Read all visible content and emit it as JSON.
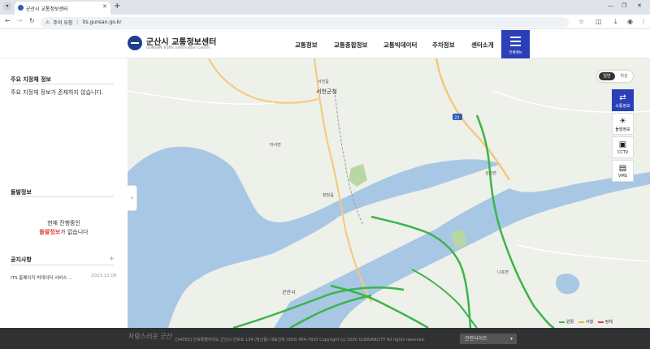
{
  "browser": {
    "tab_title": "군산시 교통정보센터",
    "warning": "주의 요함",
    "url": "its.gunsan.go.kr"
  },
  "header": {
    "logo_title": "군산시 교통정보센터",
    "logo_sub": "GUNSAN Traffic Information Center",
    "menu": [
      "교통정보",
      "교통종합정보",
      "교통빅데이터",
      "주차정보",
      "센터소개"
    ],
    "allmenu_label": "전체메뉴"
  },
  "sidebar": {
    "major": {
      "title": "주요 지정체 정보",
      "text": "주요 지정체 정보가 존재하지 않습니다."
    },
    "incident": {
      "title": "돌발정보",
      "line1": "현재 진행중인",
      "highlight": "돌발정보",
      "suffix": "가 없습니다"
    },
    "notice": {
      "title": "공지사항",
      "plus": "+",
      "item_title": "ITS 홈페이지 빅데이터 서비스 ...",
      "item_date": "2023.12.06"
    }
  },
  "map": {
    "toggle": {
      "normal": "일반",
      "satellite": "위성"
    },
    "buttons": [
      {
        "label": "소통정보",
        "icon": "⇄"
      },
      {
        "label": "돌발정보",
        "icon": "☀"
      },
      {
        "label": "CCTV",
        "icon": "▣"
      },
      {
        "label": "VMS",
        "icon": "▤"
      }
    ],
    "legend": {
      "smooth": "원활",
      "slow": "서행",
      "jam": "정체"
    },
    "labels": {
      "seocheon": "서천군청",
      "seocheon_eup": "서천읍",
      "maseo": "마서면",
      "janghang": "장항읍",
      "gunsan": "군산시",
      "seongsan": "성산면",
      "naseo": "나포면",
      "road_23": "23"
    },
    "colors": {
      "water": "#a8c7e4",
      "land": "#eef0ea",
      "smooth": "#3bb54a",
      "slow": "#f0b429",
      "jam": "#e53935"
    }
  },
  "footer": {
    "logo": "자랑스러운 군산",
    "address": "[54055] 전북특별자치도 군산시 진포로 134 (명산동)    대표전화 (063) 454-7810    Copyright (c) 2020 GUNSANCITY All rights reserved.",
    "related": "관련사이트"
  }
}
